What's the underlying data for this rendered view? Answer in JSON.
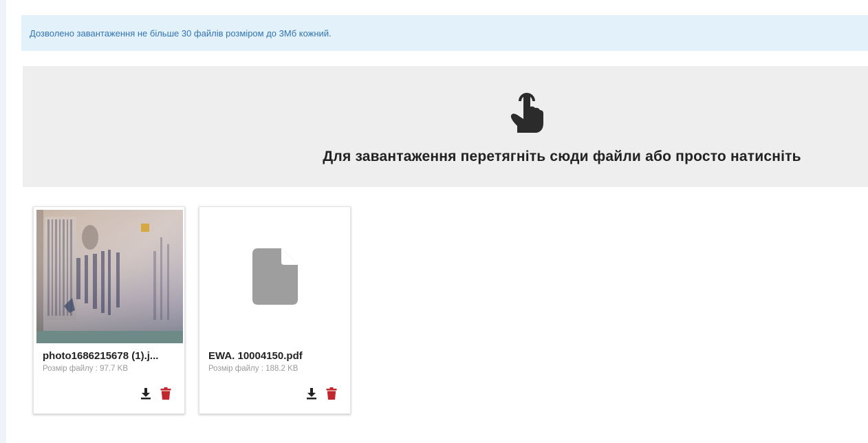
{
  "upload": {
    "notice": "Дозволено завантаження не більше 30 файлів розміром до 3Мб кожний.",
    "dropzone_text": "Для завантаження перетягніть сюди файли або просто натисніть",
    "dropzone_icon": "hand-pointer-icon"
  },
  "files": [
    {
      "name": "photo1686215678 (1).j...",
      "size_label": "Розмір файлу :",
      "size_value": "97.7 KB",
      "preview": "photo-thumbnail"
    },
    {
      "name": "EWA. 10004150.pdf",
      "size_label": "Розмір файлу :",
      "size_value": "188.2 KB",
      "preview": "file-icon"
    }
  ],
  "colors": {
    "notice_bg": "#e3f1fb",
    "notice_text": "#3174b4",
    "dropzone_bg": "#eeeeee",
    "delete_icon": "#c0282d",
    "download_icon": "#222222",
    "generic_file_icon": "#9e9e9e"
  }
}
